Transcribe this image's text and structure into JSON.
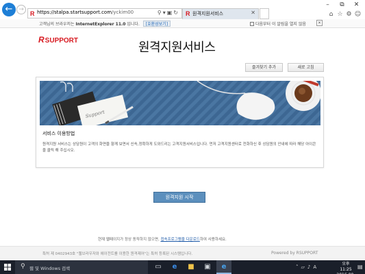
{
  "browser": {
    "url_host": "https://stalpa.startsupport.com",
    "url_path": "/yckim00",
    "tab_title": "원격지원서비스",
    "infobar": {
      "message_prefix": "고객님의 브라우저는",
      "browser_version": "InternetExplorer 11.0",
      "message_suffix": "입니다.",
      "compat_label": "[호환성보기]",
      "dont_show_label": "다음부터 이 알림을 열지 않음"
    }
  },
  "header": {
    "logo_mark": "R",
    "logo_text": "SUPPORT",
    "page_title": "원격지원서비스",
    "add_favorite": "즐겨찾기 추가",
    "refresh": "새로 고침"
  },
  "card": {
    "heading": "서비스 이용방법",
    "description": "원격지원 서비스는 상담원이 고객의 화면을 함께 보면서 신속,정확하게 도와드리는 고객지원서비스입니다. 먼저 고객지원센터로 전화하신 후 상담원의 안내에 따라 해당 아이콘을 클릭 해 주십시오.",
    "banner_note": "Support"
  },
  "main": {
    "start_button": "원격지원 시작"
  },
  "notice": {
    "prefix": "현재 웹페이지가 정상 동작하지 않으면, ",
    "link": "접속프로그램을 다운로드",
    "suffix": "하여 사용하세요."
  },
  "footer": {
    "patent": "특허 제 0402943호 \"웹브라우저와 에이전트를 이용한 원격제어\"는 특허 등록된 시스템입니다.",
    "brand": "Powered by RSUPPORT"
  },
  "taskbar": {
    "search_placeholder": "웹 및 Windows 검색",
    "time": "오후 11:25",
    "date": "2016-09-11"
  },
  "colors": {
    "brand_red": "#d71920",
    "banner_blue": "#3d6793",
    "start_button": "#5c8fbd",
    "ie_blue": "#1e7fd6"
  }
}
